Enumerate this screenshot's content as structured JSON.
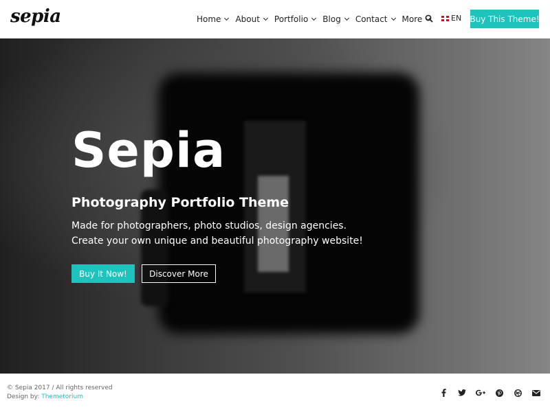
{
  "header": {
    "logo": "sepia",
    "nav": [
      {
        "label": "Home"
      },
      {
        "label": "About"
      },
      {
        "label": "Portfolio"
      },
      {
        "label": "Blog"
      },
      {
        "label": "Contact"
      },
      {
        "label": "More"
      }
    ],
    "language": "EN",
    "buy_theme_label": "Buy This Theme!"
  },
  "hero": {
    "title": "Sepia",
    "subtitle": "Photography Portfolio Theme",
    "description_line1": "Made for photographers, photo studios, design agencies.",
    "description_line2": "Create your own unique and beautiful photography website!",
    "primary_button": "Buy It Now!",
    "secondary_button": "Discover More"
  },
  "footer": {
    "copyright": "© Sepia 2017 / All rights reserved",
    "design_by_label": "Design by:",
    "designer": "Themetorium",
    "socials": [
      "facebook-icon",
      "twitter-icon",
      "google-plus-icon",
      "pinterest-icon",
      "dribbble-icon",
      "email-icon"
    ]
  },
  "colors": {
    "accent": "#1fc3be",
    "text": "#222222",
    "hero_text": "#ffffff"
  }
}
